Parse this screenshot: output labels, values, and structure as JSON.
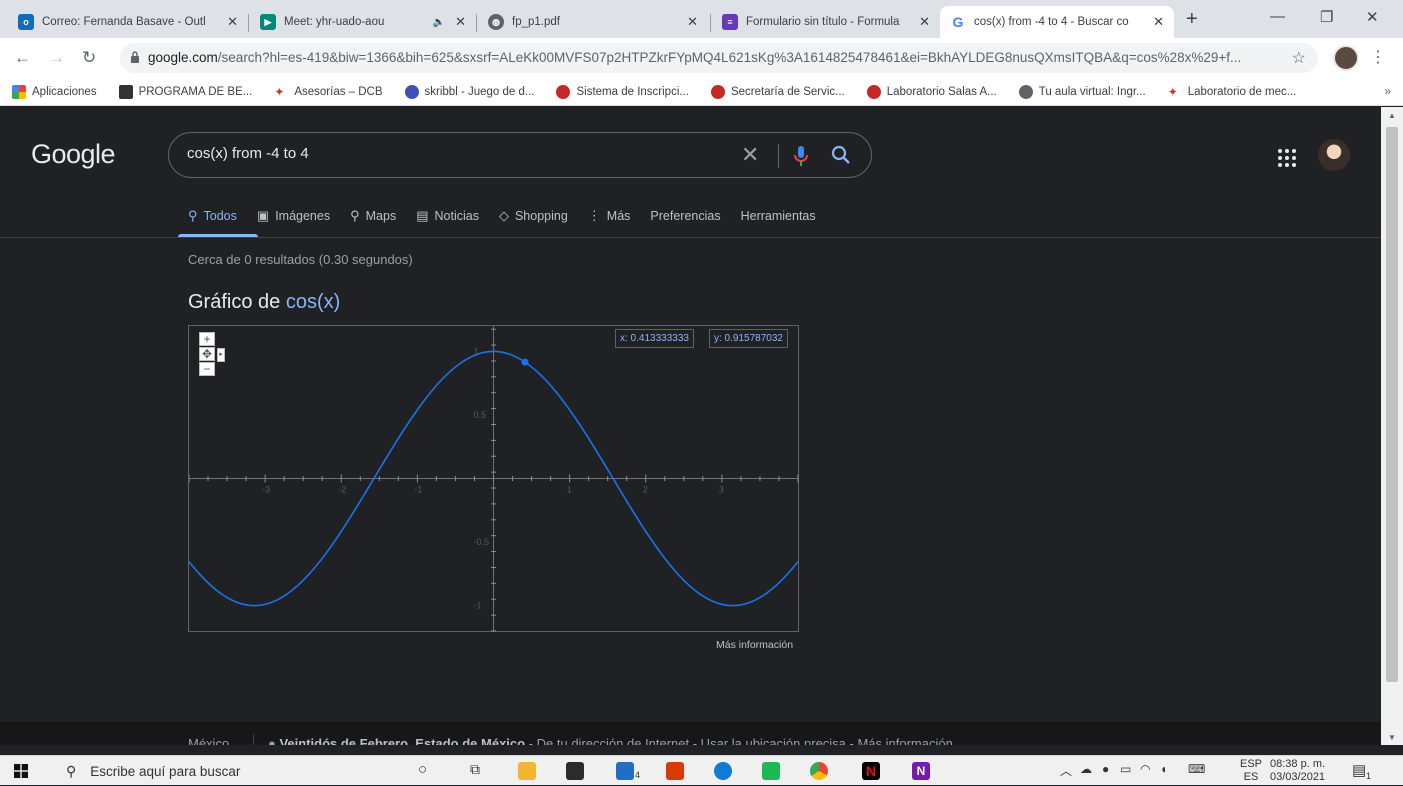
{
  "tabs": [
    {
      "title": "Correo: Fernanda Basave - Outl",
      "icon": "outlook-icon",
      "color": "#0f6cbd"
    },
    {
      "title": "Meet: yhr-uado-aou",
      "icon": "meet-icon",
      "color": "#00897b"
    },
    {
      "title": "fp_p1.pdf",
      "icon": "globe-icon",
      "color": "#5f6368"
    },
    {
      "title": "Formulario sin título - Formula",
      "icon": "forms-icon",
      "color": "#673ab7"
    },
    {
      "title": "cos(x) from -4 to 4 - Buscar co",
      "icon": "google-icon",
      "color": "#4285f4"
    }
  ],
  "address": {
    "host": "google.com",
    "path": "/search?hl=es-419&biw=1366&bih=625&sxsrf=ALeKk00MVFS07p2HTPZkrFYpMQ4L621sKg%3A1614825478461&ei=BkhAYLDEG8nusQXmsITQBA&q=cos%28x%29+f..."
  },
  "bookmarks": [
    {
      "label": "Aplicaciones",
      "icon": "apps-grid-icon",
      "color": "#4285f4"
    },
    {
      "label": "PROGRAMA DE BE...",
      "icon": "unam-icon",
      "color": "#333333"
    },
    {
      "label": "Asesorías – DCB",
      "icon": "dcb-icon",
      "color": "#d93025"
    },
    {
      "label": "skribbl - Juego de d...",
      "icon": "skribbl-icon",
      "color": "#3f51b5"
    },
    {
      "label": "Sistema de Inscripci...",
      "icon": "unam-seal-icon",
      "color": "#c62828"
    },
    {
      "label": "Secretaría de Servic...",
      "icon": "unam-seal-icon",
      "color": "#c62828"
    },
    {
      "label": "Laboratorio Salas A...",
      "icon": "unam-seal-icon",
      "color": "#c62828"
    },
    {
      "label": "Tu aula virtual: Ingr...",
      "icon": "globe-icon",
      "color": "#5f6368"
    },
    {
      "label": "Laboratorio de mec...",
      "icon": "dcb-icon",
      "color": "#d93025"
    }
  ],
  "google": {
    "logo": "Google",
    "query": "cos(x) from -4 to 4",
    "nav": [
      {
        "label": "Todos",
        "icon": "⚲"
      },
      {
        "label": "Imágenes",
        "icon": "▣"
      },
      {
        "label": "Maps",
        "icon": "⚲"
      },
      {
        "label": "Noticias",
        "icon": "▤"
      },
      {
        "label": "Shopping",
        "icon": "◇"
      },
      {
        "label": "Más",
        "icon": "⋮"
      },
      {
        "label": "Preferencias",
        "icon": ""
      },
      {
        "label": "Herramientas",
        "icon": ""
      }
    ],
    "stats": "Cerca de 0 resultados (0.30 segundos)",
    "graph_title_prefix": "Gráfico de ",
    "graph_title_fn": "cos(x)",
    "coord_x": "x: 0.413333333",
    "coord_y": "y: 0.915787032",
    "more_info": "Más información",
    "footer_country": "México",
    "footer_loc_bold": "Veintidós de Febrero, Estado de México",
    "footer_loc_rest": " - De tu dirección de Internet - Usar la ubicación precisa - Más información"
  },
  "chart_data": {
    "type": "line",
    "function": "cos(x)",
    "xlim": [
      -4,
      4
    ],
    "ylim": [
      -1.2,
      1.2
    ],
    "x_ticks": [
      -3,
      -2,
      -1,
      1,
      2,
      3
    ],
    "x_tick_labels": [
      "-3",
      "-2",
      "-1",
      "1",
      "2",
      "3"
    ],
    "y_ticks": [
      -1,
      -0.5,
      0.5,
      1
    ],
    "y_tick_labels": [
      "-1",
      "-0.5",
      "0.5",
      "1"
    ],
    "highlight_point": {
      "x": 0.413333333,
      "y": 0.915787032
    },
    "series": [
      {
        "color": "#1a73e8"
      }
    ]
  },
  "taskbar": {
    "search_placeholder": "Escribe aquí para buscar",
    "lang_top": "ESP",
    "lang_bottom": "ES",
    "time": "08:38 p. m.",
    "date": "03/03/2021",
    "mail_badge": "4",
    "notif_badge": "1"
  }
}
